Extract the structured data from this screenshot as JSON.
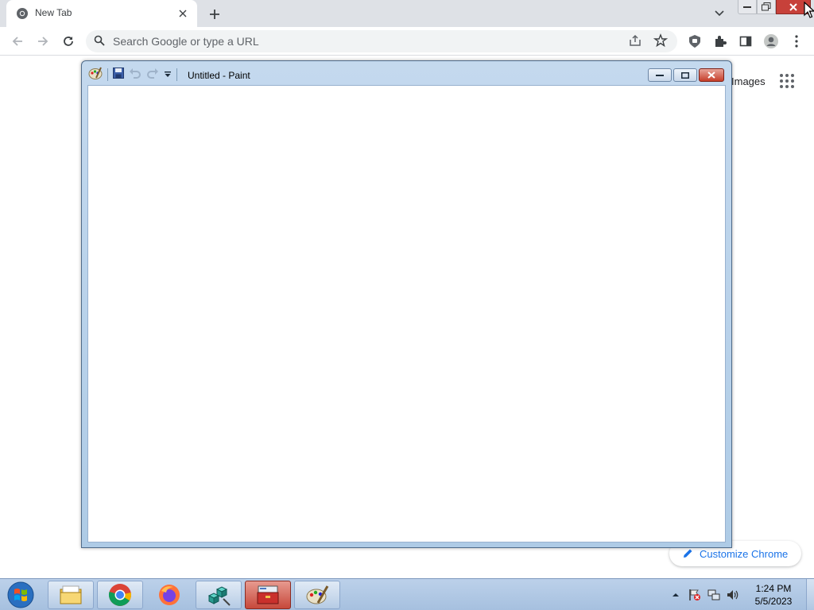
{
  "browser": {
    "tab_title": "New Tab",
    "omnibox_placeholder": "Search Google or type a URL",
    "page_images_link": "Images",
    "customize_label": "Customize Chrome"
  },
  "paint": {
    "title": "Untitled - Paint"
  },
  "taskbar": {
    "clock_time": "1:24 PM",
    "clock_date": "5/5/2023",
    "pinned": [
      "file-explorer-icon",
      "chrome-icon",
      "firefox-icon",
      "cubes-app-icon",
      "toolbox-app-icon",
      "paint-icon"
    ]
  },
  "colors": {
    "chrome_tabstrip": "#dee1e6",
    "accent": "#1a73e8",
    "close_red": "#c7413a",
    "paint_frame": "#c4d9ee"
  }
}
